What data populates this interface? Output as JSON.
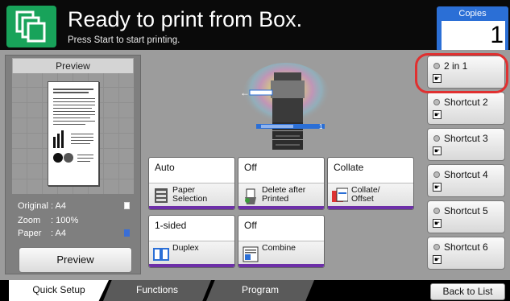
{
  "header": {
    "title": "Ready to print from Box.",
    "subtitle": "Press Start to start printing.",
    "copies_label": "Copies",
    "copies_value": "1"
  },
  "preview": {
    "heading": "Preview",
    "original_label": "Original",
    "original_value": ": A4",
    "zoom_label": "Zoom",
    "zoom_value": ": 100%",
    "paper_label": "Paper",
    "paper_value": ": A4",
    "button_label": "Preview"
  },
  "functions": {
    "paper_selection": {
      "value": "Auto",
      "label_line1": "Paper",
      "label_line2": "Selection"
    },
    "delete_after_printed": {
      "value": "Off",
      "label_line1": "Delete after",
      "label_line2": "Printed"
    },
    "collate_offset": {
      "value": "Collate",
      "label_line1": "Collate/",
      "label_line2": "Offset"
    },
    "duplex": {
      "value": "1-sided",
      "label_line1": "Duplex",
      "label_line2": ""
    },
    "combine": {
      "value": "Off",
      "label_line1": "Combine",
      "label_line2": ""
    }
  },
  "shortcuts": [
    {
      "label": "2 in 1"
    },
    {
      "label": "Shortcut 2"
    },
    {
      "label": "Shortcut 3"
    },
    {
      "label": "Shortcut 4"
    },
    {
      "label": "Shortcut 5"
    },
    {
      "label": "Shortcut 6"
    }
  ],
  "tabs": {
    "quick_setup": "Quick Setup",
    "functions": "Functions",
    "program": "Program"
  },
  "back_to_list": "Back to List",
  "printer_counter": "1",
  "colors": {
    "app_icon": "#18a35a",
    "copies_accent": "#2b6fd6",
    "function_bar": "#6d2fa8",
    "highlight": "#e03030"
  }
}
